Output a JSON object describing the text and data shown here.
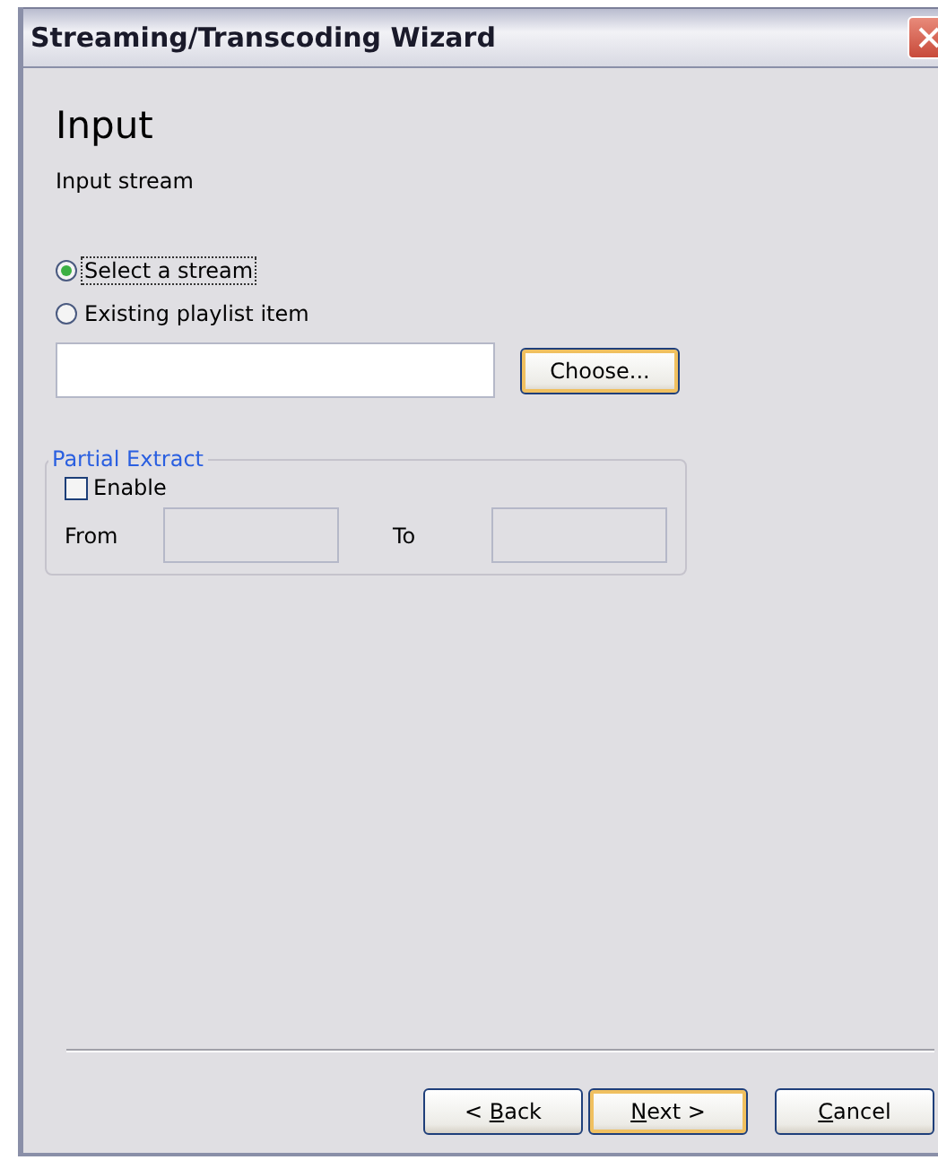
{
  "window": {
    "title": "Streaming/Transcoding Wizard"
  },
  "page": {
    "heading": "Input",
    "subheading": "Input stream"
  },
  "source_options": [
    {
      "label": "Select a stream",
      "selected": true,
      "focused": true
    },
    {
      "label": "Existing playlist item",
      "selected": false,
      "focused": false
    }
  ],
  "source_field": {
    "disabled": false
  },
  "choose_button": {
    "label": "Choose...",
    "default": true
  },
  "partial_extract": {
    "title": "Partial Extract",
    "enable": {
      "label": "Enable",
      "checked": false
    },
    "from": {
      "label": "From"
    },
    "to": {
      "label": "To"
    }
  },
  "buttons": [
    {
      "before": "< ",
      "key": "B",
      "after": "ack",
      "default": false
    },
    {
      "key": "N",
      "after": "ext >",
      "default": true
    },
    {
      "key": "C",
      "after": "ancel",
      "default": false
    }
  ]
}
